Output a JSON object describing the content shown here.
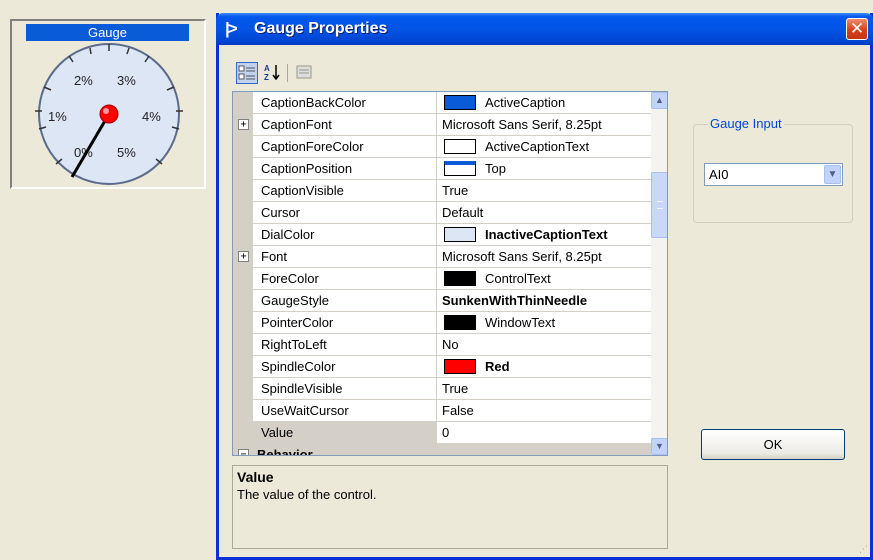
{
  "gauge": {
    "caption": "Gauge",
    "tick_labels": [
      "0%",
      "1%",
      "2%",
      "3%",
      "4%",
      "5%"
    ],
    "value": 0,
    "colors": {
      "caption_back": "#0a5bd8",
      "dial": "#dde6f5",
      "spindle": "#ff0000",
      "pointer": "#000000"
    }
  },
  "dialog": {
    "title": "Gauge Properties",
    "title_icon": "arrow-logo-icon",
    "close_glyph": "✕"
  },
  "toolbar": {
    "categorized_icon": "categorized-icon",
    "alphabetical_icon": "sort-az-icon",
    "property_pages_icon": "property-pages-icon"
  },
  "properties": [
    {
      "name": "CaptionBackColor",
      "value": "ActiveCaption",
      "swatch": "#0a5bd8"
    },
    {
      "name": "CaptionFont",
      "value": "Microsoft Sans Serif, 8.25pt",
      "expandable": true
    },
    {
      "name": "CaptionForeColor",
      "value": "ActiveCaptionText",
      "swatch": "#ffffff"
    },
    {
      "name": "CaptionPosition",
      "value": "Top",
      "swatch": "#ffffff"
    },
    {
      "name": "CaptionVisible",
      "value": "True"
    },
    {
      "name": "Cursor",
      "value": "Default"
    },
    {
      "name": "DialColor",
      "value": "InactiveCaptionText",
      "swatch": "#dde6f5",
      "bold": true
    },
    {
      "name": "Font",
      "value": "Microsoft Sans Serif, 8.25pt",
      "expandable": true
    },
    {
      "name": "ForeColor",
      "value": "ControlText",
      "swatch": "#000000"
    },
    {
      "name": "GaugeStyle",
      "value": "SunkenWithThinNeedle",
      "bold": true
    },
    {
      "name": "PointerColor",
      "value": "WindowText",
      "swatch": "#000000"
    },
    {
      "name": "RightToLeft",
      "value": "No"
    },
    {
      "name": "SpindleColor",
      "value": "Red",
      "swatch": "#ff0000",
      "bold": true
    },
    {
      "name": "SpindleVisible",
      "value": "True"
    },
    {
      "name": "UseWaitCursor",
      "value": "False"
    },
    {
      "name": "Value",
      "value": "0",
      "selected": true
    }
  ],
  "category": {
    "name": "Behavior",
    "toggle": "⊟"
  },
  "description": {
    "title": "Value",
    "text": "The value of the control."
  },
  "gauge_input": {
    "label": "Gauge Input",
    "selected": "AI0"
  },
  "ok_label": "OK"
}
